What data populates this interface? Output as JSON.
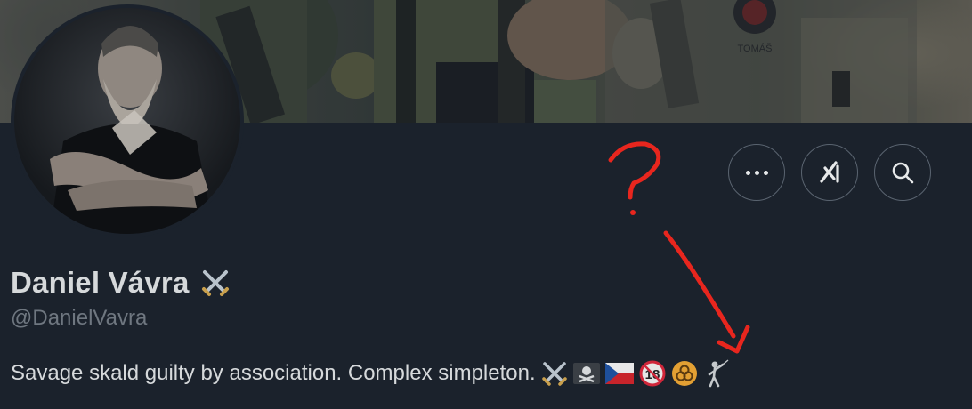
{
  "profile": {
    "display_name": "Daniel Vávra",
    "handle": "@DanielVavra",
    "bio_text": "Savage skald guilty by association. Complex simpleton.",
    "name_emoji": "crossed-swords",
    "bio_emojis": [
      "crossed-swords",
      "pirate-flag",
      "czech-flag",
      "no-under-18",
      "biohazard",
      "fencer"
    ]
  },
  "banner": {
    "shirt_text": "TOMÁŠ"
  },
  "actions": {
    "more": "more-icon",
    "grok": "grok-icon",
    "search": "search-icon"
  },
  "annotation": {
    "mark": "?",
    "color": "#e8261e"
  },
  "colors": {
    "background": "#1b222c",
    "text": "#d6d9db",
    "muted": "#6f7780",
    "border": "#5a6470"
  }
}
